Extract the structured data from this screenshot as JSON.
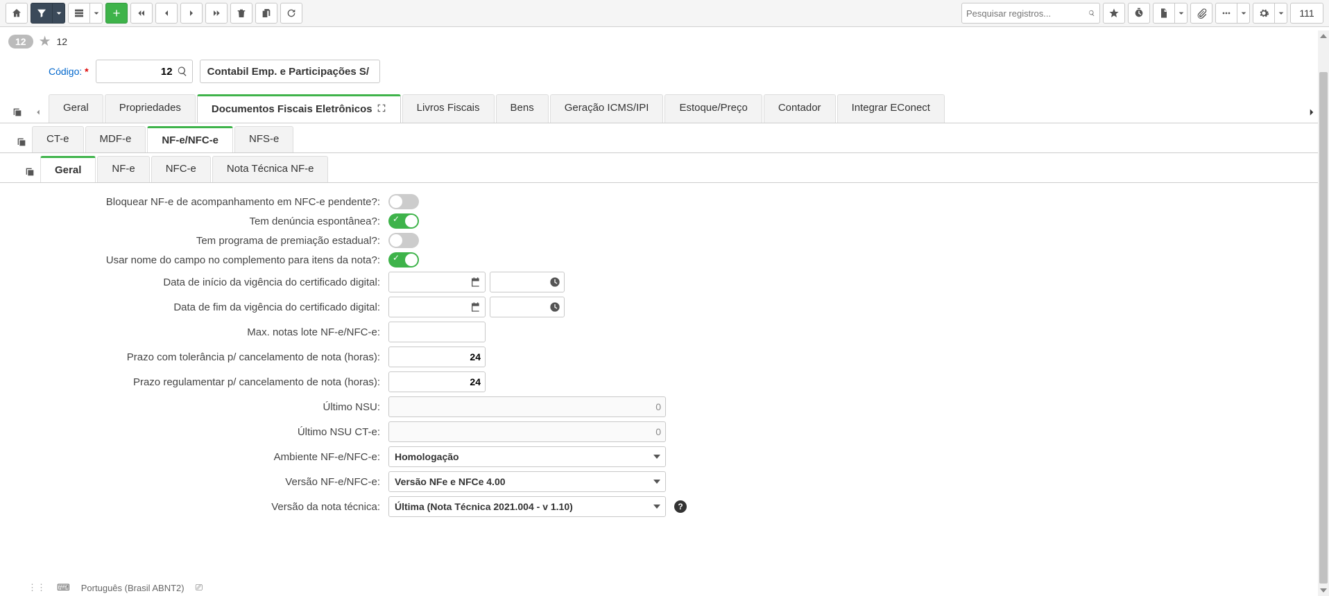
{
  "toolbar": {
    "search_placeholder": "Pesquisar registros...",
    "record_count": "111"
  },
  "breadcrumb": {
    "badge": "12",
    "text": "12"
  },
  "header": {
    "code_label": "Código:",
    "code_value": "12",
    "title_value": "Contabil Emp. e Participações S/"
  },
  "tabs": {
    "main": [
      "Geral",
      "Propriedades",
      "Documentos Fiscais Eletrônicos",
      "Livros Fiscais",
      "Bens",
      "Geração ICMS/IPI",
      "Estoque/Preço",
      "Contador",
      "Integrar EConect"
    ],
    "main_active": 2,
    "doc": [
      "CT-e",
      "MDF-e",
      "NF-e/NFC-e",
      "NFS-e"
    ],
    "doc_active": 2,
    "sub": [
      "Geral",
      "NF-e",
      "NFC-e",
      "Nota Técnica NF-e"
    ],
    "sub_active": 0
  },
  "form": {
    "bloquear_label": "Bloquear NF-e de acompanhamento em NFC-e pendente?:",
    "bloquear_on": false,
    "denuncia_label": "Tem denúncia espontânea?:",
    "denuncia_on": true,
    "premiacao_label": "Tem programa de premiação estadual?:",
    "premiacao_on": false,
    "nomecampo_label": "Usar nome do campo no complemento para itens da nota?:",
    "nomecampo_on": true,
    "cert_inicio_label": "Data de início da vigência do certificado digital:",
    "cert_inicio_date": "",
    "cert_inicio_time": "",
    "cert_fim_label": "Data de fim da vigência do certificado digital:",
    "cert_fim_date": "",
    "cert_fim_time": "",
    "maxlote_label": "Max. notas lote NF-e/NFC-e:",
    "maxlote_value": "",
    "prazo_tol_label": "Prazo com tolerância p/ cancelamento de nota (horas):",
    "prazo_tol_value": "24",
    "prazo_reg_label": "Prazo regulamentar p/ cancelamento de nota (horas):",
    "prazo_reg_value": "24",
    "ultnsu_label": "Último NSU:",
    "ultnsu_value": "0",
    "ultnsucte_label": "Último NSU CT-e:",
    "ultnsucte_value": "0",
    "ambiente_label": "Ambiente NF-e/NFC-e:",
    "ambiente_value": "Homologação",
    "versao_label": "Versão NF-e/NFC-e:",
    "versao_value": "Versão NFe e NFCe 4.00",
    "versao_nt_label": "Versão da nota técnica:",
    "versao_nt_value": "Última (Nota Técnica 2021.004 - v 1.10)"
  },
  "status": {
    "lang": "Português (Brasil ABNT2)"
  }
}
